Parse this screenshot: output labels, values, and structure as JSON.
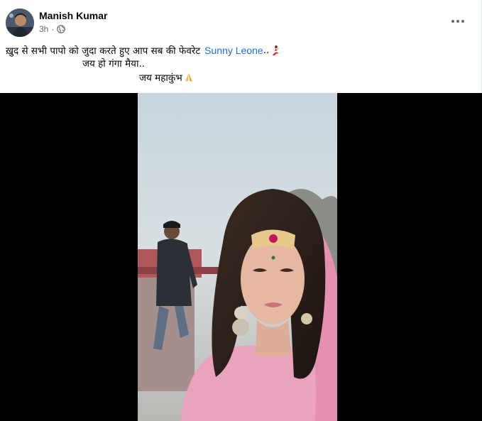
{
  "post": {
    "author": "Manish Kumar",
    "time": "3h",
    "privacy_icon": "globe-icon",
    "more_icon": "more-options-icon",
    "text": {
      "line1": "ख़ुद से सभी पापो को जुदा करते हुए आप सब की फेवरेट",
      "tagged_name": "Sunny Leone",
      "line1_suffix": "..",
      "line2": "जय हो गंगा मैया..",
      "line3": "जय महाकुंभ"
    },
    "emoji": {
      "line1": "dancer-emoji",
      "line3": "folded-hands-emoji"
    }
  },
  "colors": {
    "link": "#216fdb",
    "secondary_text": "#65676b",
    "media_background": "#000000"
  }
}
